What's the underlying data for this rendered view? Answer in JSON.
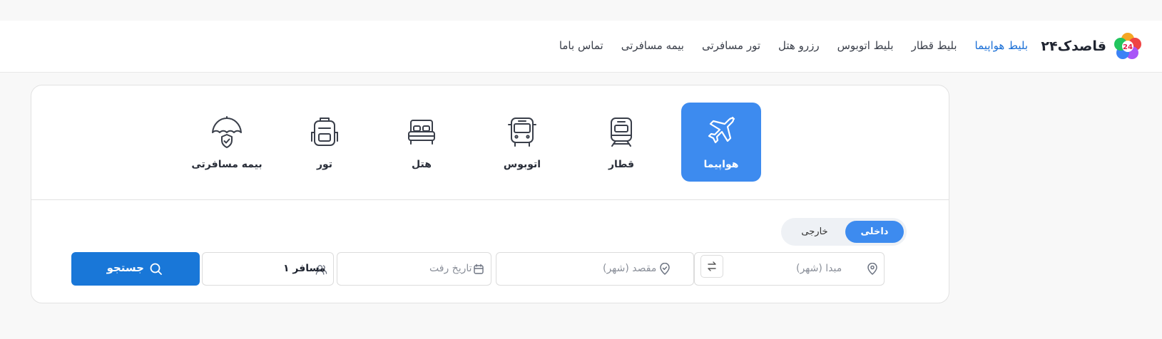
{
  "brand": {
    "name": "قاصدک۲۴",
    "badge": "24"
  },
  "nav": {
    "items": [
      {
        "label": "بلیط هواپیما",
        "active": true
      },
      {
        "label": "بلیط قطار",
        "active": false
      },
      {
        "label": "بلیط اتوبوس",
        "active": false
      },
      {
        "label": "رزرو هتل",
        "active": false
      },
      {
        "label": "تور مسافرتی",
        "active": false
      },
      {
        "label": "بیمه مسافرتی",
        "active": false
      },
      {
        "label": "تماس باما",
        "active": false
      }
    ]
  },
  "services": [
    {
      "label": "هواپیما",
      "icon": "airplane-icon",
      "active": true
    },
    {
      "label": "قطار",
      "icon": "train-icon",
      "active": false
    },
    {
      "label": "اتوبوس",
      "icon": "bus-icon",
      "active": false
    },
    {
      "label": "هتل",
      "icon": "bed-icon",
      "active": false
    },
    {
      "label": "تور",
      "icon": "backpack-icon",
      "active": false
    },
    {
      "label": "بیمه مسافرتی",
      "icon": "umbrella-shield-icon",
      "active": false
    }
  ],
  "trip_type": {
    "domestic": "داخلی",
    "international": "خارجی",
    "selected": "domestic"
  },
  "search": {
    "origin_placeholder": "مبدا (شهر)",
    "destination_placeholder": "مقصد (شهر)",
    "date_placeholder": "تاریخ رفت",
    "passengers_value": "۱ مسافر",
    "button_label": "جستجو"
  },
  "colors": {
    "primary": "#3d8bef",
    "button": "#1977d8",
    "nav_active": "#1a6fd6"
  }
}
